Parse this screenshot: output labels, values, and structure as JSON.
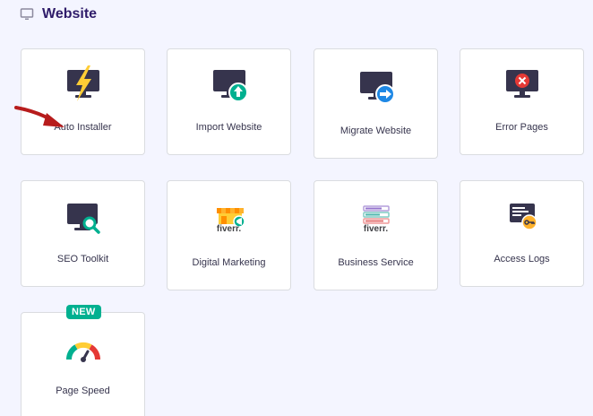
{
  "section": {
    "title": "Website",
    "icon": "monitor-icon"
  },
  "cards": [
    {
      "label": "Auto Installer",
      "icon": "monitor-lightning-icon"
    },
    {
      "label": "Import Website",
      "icon": "monitor-upload-icon"
    },
    {
      "label": "Migrate Website",
      "icon": "monitor-arrow-right-icon"
    },
    {
      "label": "Error Pages",
      "icon": "monitor-error-icon"
    },
    {
      "label": "SEO Toolkit",
      "icon": "monitor-search-icon"
    },
    {
      "label": "Digital Marketing",
      "icon": "fiverr-store-icon",
      "brand": "fiverr."
    },
    {
      "label": "Business Service",
      "icon": "fiverr-list-icon",
      "brand": "fiverr."
    },
    {
      "label": "Access Logs",
      "icon": "log-key-icon"
    },
    {
      "label": "Page Speed",
      "icon": "speedometer-icon",
      "badge": "NEW"
    }
  ],
  "colors": {
    "accent_purple": "#673de6",
    "green": "#00b090",
    "blue": "#1e88e5",
    "red": "#e53935",
    "yellow": "#ffcd35",
    "dark": "#36344d"
  }
}
